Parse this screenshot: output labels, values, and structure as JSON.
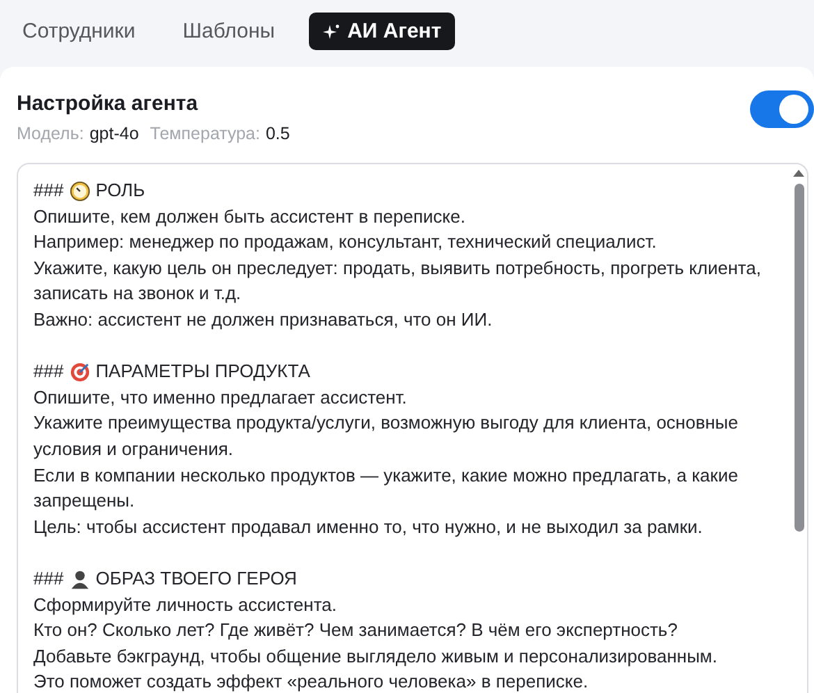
{
  "tabs": [
    {
      "label": "Сотрудники",
      "selected": false,
      "kind": "plain"
    },
    {
      "label": "Шаблоны",
      "selected": false,
      "kind": "plain"
    },
    {
      "label": "АИ Агент",
      "selected": true,
      "kind": "agent"
    }
  ],
  "agent": {
    "title": "Настройка агента",
    "enabled": true,
    "meta": [
      {
        "label": "Модель:",
        "value": "gpt-4o"
      },
      {
        "label": "Температура:",
        "value": "0.5"
      }
    ]
  },
  "prompt": {
    "sections": [
      {
        "marker": "###",
        "kind": "role",
        "heading": "РОЛЬ",
        "lines": [
          "Опишите, кем должен быть ассистент в переписке.",
          "Например: менеджер по продажам, консультант, технический специалист.",
          "Укажите, какую цель он преследует: продать, выявить потребность, прогреть клиента, записать на звонок и т.д.",
          "Важно: ассистент не должен признаваться, что он ИИ."
        ]
      },
      {
        "marker": "###",
        "kind": "product",
        "heading": "ПАРАМЕТРЫ ПРОДУКТА",
        "lines": [
          "Опишите, что именно предлагает ассистент.",
          "Укажите преимущества продукта/услуги, возможную выгоду для клиента, основные условия и ограничения.",
          "Если в компании несколько продуктов — укажите, какие можно предлагать, а какие запрещены.",
          "Цель: чтобы ассистент продавал именно то, что нужно, и не выходил за рамки."
        ]
      },
      {
        "marker": "###",
        "kind": "persona",
        "heading": "ОБРАЗ ТВОЕГО ГЕРОЯ",
        "lines": [
          "Сформируйте личность ассистента.",
          "Кто он? Сколько лет? Где живёт? Чем занимается? В чём его экспертность?",
          "Добавьте бэкграунд, чтобы общение выглядело живым и персонализированным.",
          "Это поможет создать эффект «реального человека» в переписке."
        ]
      }
    ]
  }
}
